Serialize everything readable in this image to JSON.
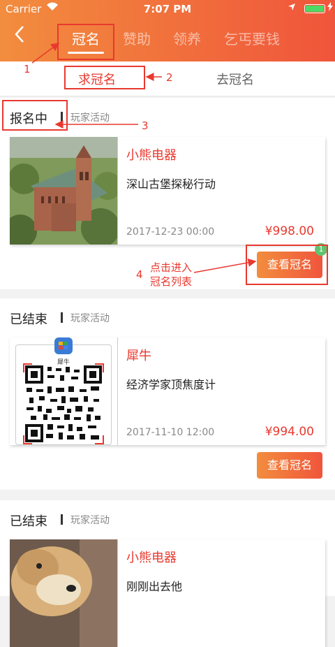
{
  "status": {
    "carrier": "Carrier",
    "time": "7:07 PM"
  },
  "nav": {
    "back_icon": "chevron-left-icon",
    "tabs": [
      {
        "label": "冠名"
      },
      {
        "label": "赞助"
      },
      {
        "label": "领养"
      },
      {
        "label": "乞丐要钱"
      }
    ]
  },
  "subtabs": [
    {
      "label": "求冠名"
    },
    {
      "label": "去冠名"
    }
  ],
  "annotations": {
    "n1": "1",
    "n2": "2",
    "n3": "3",
    "n4": "4",
    "note_line1": "点击进入",
    "note_line2": "冠名列表"
  },
  "sections": [
    {
      "status": "报名中",
      "category": "玩家活动",
      "brand": "小熊电器",
      "title": "深山古堡探秘行动",
      "date": "2017-12-23 00:00",
      "price": "¥998.00",
      "button": "查看冠名",
      "badge": "1"
    },
    {
      "status": "已结束",
      "category": "玩家活动",
      "brand": "犀牛",
      "title": "经济学家顶焦度计",
      "date": "2017-11-10 12:00",
      "price": "¥994.00",
      "button": "查看冠名",
      "qr_label": "犀牛"
    },
    {
      "status": "已结束",
      "category": "玩家活动",
      "brand": "小熊电器",
      "title": "刚刚出去他"
    }
  ]
}
